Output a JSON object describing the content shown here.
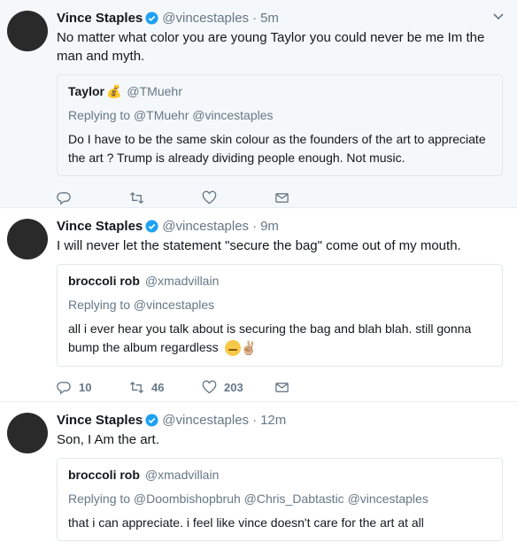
{
  "tweets": [
    {
      "author_name": "Vince Staples",
      "author_handle": "@vincestaples",
      "time": "5m",
      "separator": "·",
      "text": "No matter what color you are young Taylor you could never be me Im the man and myth.",
      "quote": {
        "name": "Taylor",
        "name_emoji": "💰",
        "handle": "@TMuehr",
        "replying_to": "Replying to @TMuehr @vincestaples",
        "text": "Do I have to be the same skin colour as the founders of the art to appreciate the art ? Trump is already dividing people enough. Not music."
      },
      "actions": {
        "reply": "",
        "retweet": "",
        "like": ""
      }
    },
    {
      "author_name": "Vince Staples",
      "author_handle": "@vincestaples",
      "time": "9m",
      "separator": "·",
      "text": "I will never let the statement  \"secure the bag\" come out of my mouth.",
      "quote": {
        "name": "broccoli rob",
        "handle": "@xmadvillain",
        "replying_to": "Replying to @vincestaples",
        "text": "all i ever hear you talk about is securing the bag and blah blah. still gonna bump the album regardless",
        "text_emoji": "✌🏼"
      },
      "actions": {
        "reply": "10",
        "retweet": "46",
        "like": "203"
      }
    },
    {
      "author_name": "Vince Staples",
      "author_handle": "@vincestaples",
      "time": "12m",
      "separator": "·",
      "text": "Son, I Am the art.",
      "quote": {
        "name": "broccoli rob",
        "handle": "@xmadvillain",
        "replying_to": "Replying to @Doombishopbruh @Chris_Dabtastic @vincestaples",
        "text": "that i can appreciate. i feel like vince doesn't care for the art at all"
      }
    }
  ],
  "colors": {
    "verified_blue": "#1da1f2",
    "muted_text": "#657786",
    "highlight_bg": "#f5f8fa",
    "border": "#e6ecf0"
  },
  "icons": {
    "verified": "verified-badge-icon",
    "caret": "chevron-down-icon",
    "reply": "reply-icon",
    "retweet": "retweet-icon",
    "like": "heart-icon",
    "dm": "envelope-icon"
  }
}
